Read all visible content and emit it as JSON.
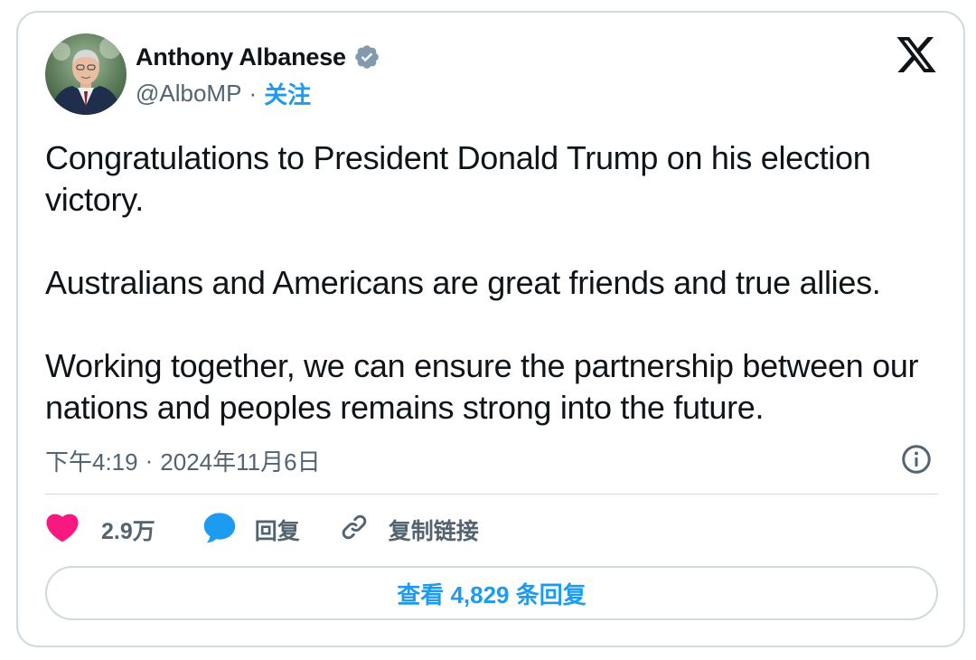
{
  "author": {
    "display_name": "Anthony Albanese",
    "handle": "@AlboMP",
    "separator": "·",
    "follow_label": "关注",
    "verified": true
  },
  "tweet": {
    "paragraphs": [
      "Congratulations to President Donald Trump on his election victory.",
      "Australians and Americans are great friends and true allies.",
      "Working together, we can ensure the partnership between our nations and peoples remains strong into the future."
    ]
  },
  "meta": {
    "time": "下午4:19",
    "separator": "·",
    "date": "2024年11月6日"
  },
  "actions": {
    "like_count": "2.9万",
    "reply_label": "回复",
    "copy_link_label": "复制链接"
  },
  "view_replies_label": "查看 4,829 条回复",
  "icons": {
    "logo": "x-logo-icon",
    "verified": "verified-badge-icon",
    "info": "info-icon",
    "like": "heart-icon",
    "reply": "speech-bubble-icon",
    "copy": "link-icon"
  },
  "colors": {
    "accent": "#1d9bf0",
    "like": "#f91880",
    "text_primary": "#0f1419",
    "text_secondary": "#536471",
    "border": "#cfd9de",
    "verified_badge": "#829aab"
  }
}
